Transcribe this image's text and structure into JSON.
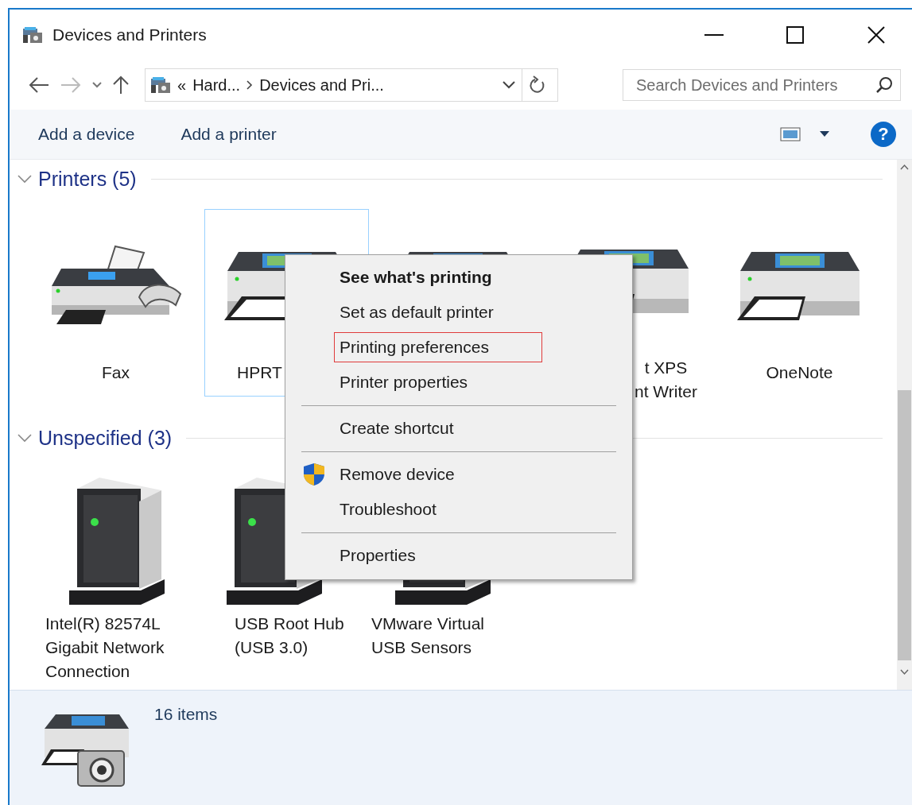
{
  "window": {
    "title": "Devices and Printers"
  },
  "breadcrumb": {
    "overflow": "«",
    "items": [
      "Hard...",
      "Devices and Pri..."
    ]
  },
  "search": {
    "placeholder": "Search Devices and Printers"
  },
  "commands": [
    "Add a device",
    "Add a printer"
  ],
  "help": "?",
  "groups": [
    {
      "title": "Printers (5)",
      "expanded": true,
      "kind": "printers",
      "items": [
        {
          "kind": "fax",
          "label": [
            "Fax"
          ],
          "selected": false
        },
        {
          "kind": "printer",
          "label": [
            "HPRT"
          ],
          "selected": true
        },
        {
          "kind": "printer",
          "selected": false
        },
        {
          "kind": "printer",
          "label": [
            "t XPS",
            "nt Writer"
          ],
          "selected": false
        },
        {
          "kind": "printer",
          "label": [
            "OneNote"
          ],
          "selected": false
        }
      ]
    },
    {
      "title": "Unspecified (3)",
      "expanded": true,
      "kind": "devices",
      "items": [
        {
          "kind": "tower",
          "label": [
            "Intel(R) 82574L",
            "Gigabit Network",
            "Connection"
          ],
          "selected": false
        },
        {
          "kind": "tower",
          "label": [
            "USB Root Hub",
            "(USB 3.0)"
          ],
          "selected": false
        },
        {
          "kind": "tower",
          "label": [
            "VMware Virtual",
            "USB Sensors"
          ],
          "selected": false
        }
      ]
    }
  ],
  "context_menu": [
    {
      "kind": "item",
      "label": "See what's printing",
      "default": true,
      "highlighted": false
    },
    {
      "kind": "item",
      "label": "Set as default printer",
      "default": false,
      "highlighted": false
    },
    {
      "kind": "item",
      "label": "Printing preferences",
      "default": false,
      "highlighted": true
    },
    {
      "kind": "item",
      "label": "Printer properties",
      "default": false,
      "highlighted": false
    },
    {
      "kind": "separator"
    },
    {
      "kind": "item",
      "label": "Create shortcut",
      "default": false,
      "highlighted": false
    },
    {
      "kind": "separator"
    },
    {
      "kind": "item",
      "label": "Remove device",
      "default": false,
      "highlighted": false,
      "shield": true
    },
    {
      "kind": "item",
      "label": "Troubleshoot",
      "default": false,
      "highlighted": false
    },
    {
      "kind": "separator"
    },
    {
      "kind": "item",
      "label": "Properties",
      "default": false,
      "highlighted": false
    }
  ],
  "status_bar": {
    "count": "16 items"
  }
}
